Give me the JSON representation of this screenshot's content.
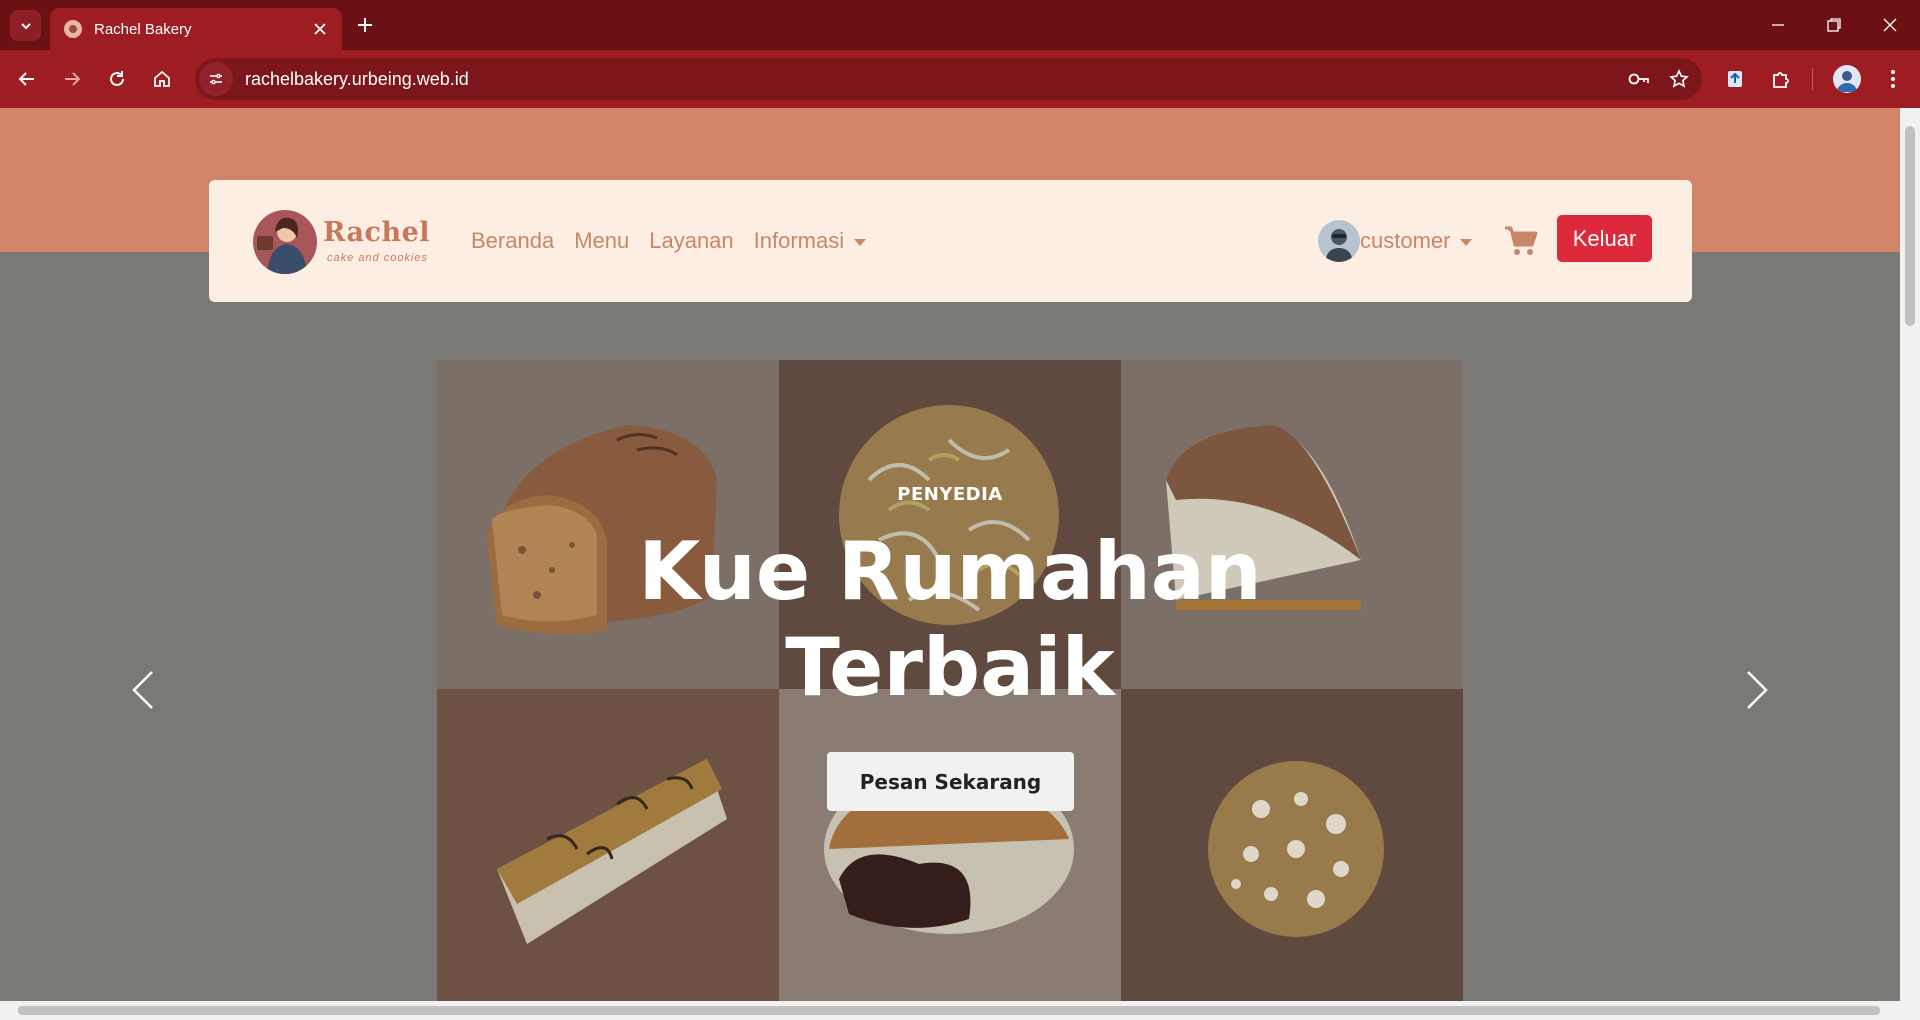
{
  "browser": {
    "tab_title": "Rachel Bakery",
    "url": "rachelbakery.urbeing.web.id"
  },
  "navbar": {
    "brand_name": "Rachel",
    "brand_tagline": "cake and cookies",
    "links": [
      "Beranda",
      "Menu",
      "Layanan",
      "Informasi"
    ],
    "user_label": "customer",
    "logout_label": "Keluar"
  },
  "hero": {
    "eyebrow": "PENYEDIA",
    "title_line1": "Kue Rumahan",
    "title_line2": "Terbaik",
    "cta_label": "Pesan Sekarang"
  },
  "colors": {
    "chrome_dark": "#6b1114",
    "chrome": "#9e1d22",
    "band": "#d3856b",
    "navbar_bg": "#fdeee4",
    "nav_text": "#c88767",
    "logout": "#dc2a3c"
  },
  "icons": [
    "tab-list-icon",
    "favicon",
    "close-icon",
    "plus-icon",
    "minimize-icon",
    "restore-icon",
    "window-close-icon",
    "back-icon",
    "forward-icon",
    "reload-icon",
    "home-icon",
    "site-info-icon",
    "key-icon",
    "star-icon",
    "extension-pin-icon",
    "puzzle-icon",
    "profile-icon",
    "kebab-menu-icon",
    "cart-icon",
    "chevron-left-icon",
    "chevron-right-icon"
  ]
}
